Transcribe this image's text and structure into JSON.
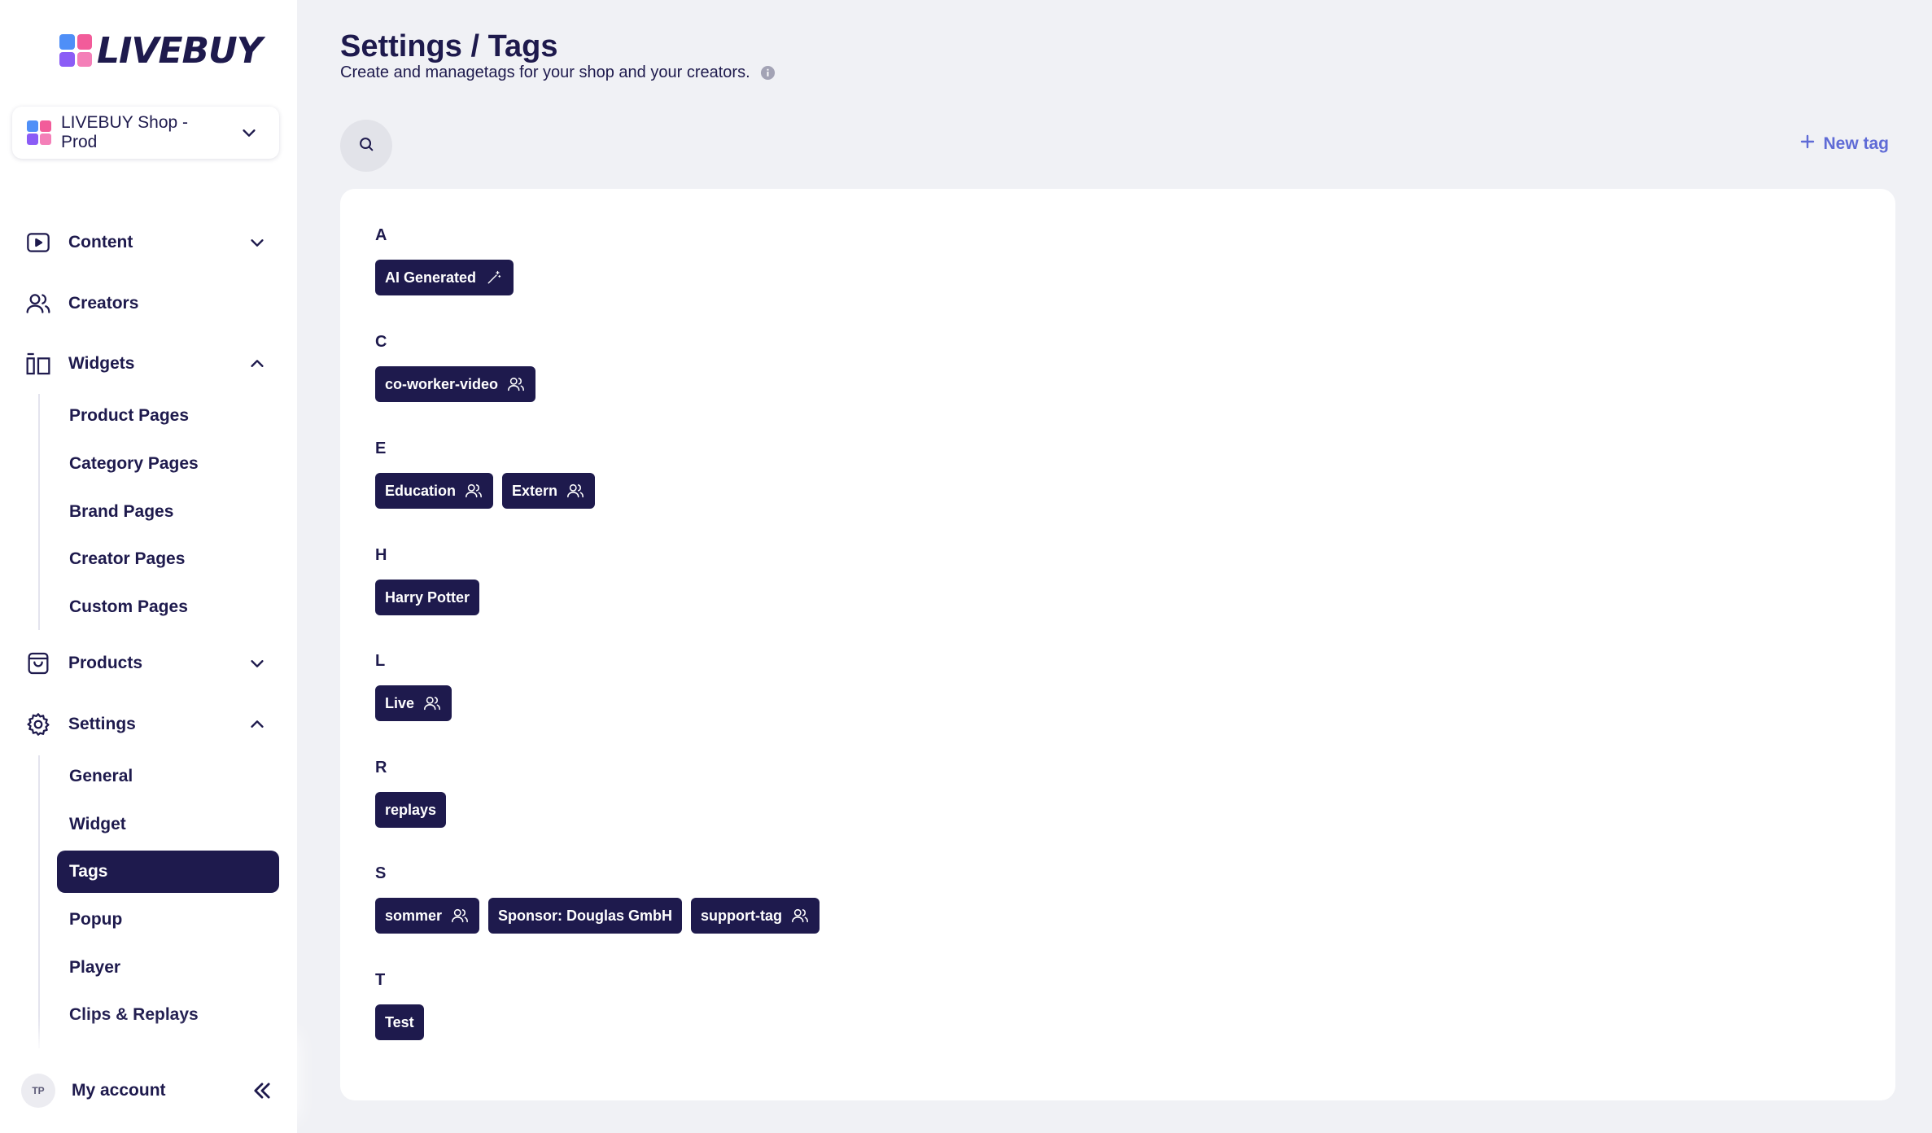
{
  "app": {
    "logo_text": "LIVEBUY"
  },
  "shop_selector": {
    "value": "LIVEBUY Shop - Prod"
  },
  "nav": {
    "content": "Content",
    "creators": "Creators",
    "widgets": "Widgets",
    "widgets_items": [
      "Product Pages",
      "Category Pages",
      "Brand Pages",
      "Creator Pages",
      "Custom Pages"
    ],
    "products": "Products",
    "settings": "Settings",
    "settings_items": [
      "General",
      "Widget",
      "Tags",
      "Popup",
      "Player",
      "Clips & Replays"
    ],
    "active_item": "Tags"
  },
  "account": {
    "initials": "TP",
    "label": "My account"
  },
  "page": {
    "title": "Settings / Tags",
    "subtitle": "Create and managetags for your shop and your creators."
  },
  "toolbar": {
    "new_tag_label": "New tag"
  },
  "tag_groups": [
    {
      "letter": "A",
      "tags": [
        {
          "label": "AI Generated",
          "icon": "magic-wand-icon"
        }
      ]
    },
    {
      "letter": "C",
      "tags": [
        {
          "label": "co-worker-video",
          "icon": "users-icon"
        }
      ]
    },
    {
      "letter": "E",
      "tags": [
        {
          "label": "Education",
          "icon": "users-icon"
        },
        {
          "label": "Extern",
          "icon": "users-icon"
        }
      ]
    },
    {
      "letter": "H",
      "tags": [
        {
          "label": "Harry Potter",
          "icon": ""
        }
      ]
    },
    {
      "letter": "L",
      "tags": [
        {
          "label": "Live",
          "icon": "users-icon"
        }
      ]
    },
    {
      "letter": "R",
      "tags": [
        {
          "label": "replays",
          "icon": ""
        }
      ]
    },
    {
      "letter": "S",
      "tags": [
        {
          "label": "sommer",
          "icon": "users-icon"
        },
        {
          "label": "Sponsor: Douglas GmbH",
          "icon": ""
        },
        {
          "label": "support-tag",
          "icon": "users-icon"
        }
      ]
    },
    {
      "letter": "T",
      "tags": [
        {
          "label": "Test",
          "icon": ""
        }
      ]
    }
  ],
  "colors": {
    "primary": "#1e1a4d",
    "accent": "#5f6bd6",
    "background": "#f0f1f5"
  }
}
